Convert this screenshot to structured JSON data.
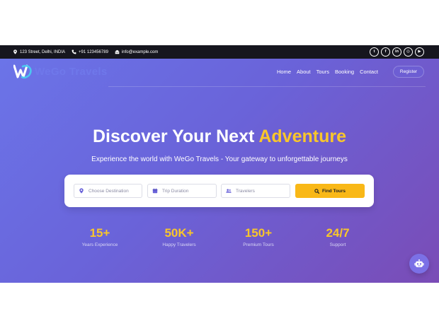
{
  "topbar": {
    "address": "123 Street, Delhi, INDIA",
    "phone": "+91 123456789",
    "email": "info@example.com",
    "social": [
      {
        "icon": "twitter-icon",
        "glyph": "t"
      },
      {
        "icon": "facebook-icon",
        "glyph": "f"
      },
      {
        "icon": "linkedin-icon",
        "glyph": "in"
      },
      {
        "icon": "instagram-icon",
        "glyph": "◎"
      },
      {
        "icon": "youtube-icon",
        "glyph": "▶"
      }
    ]
  },
  "brand": {
    "name": "WeGo Travels",
    "logo_text": "W"
  },
  "nav": {
    "items": [
      "Home",
      "About",
      "Tours",
      "Booking",
      "Contact"
    ],
    "register_label": "Register"
  },
  "hero": {
    "title_main": "Discover Your Next",
    "title_accent": "Adventure",
    "subtitle": "Experience the world with WeGo Travels - Your gateway to unforgettable journeys"
  },
  "search": {
    "destination_placeholder": "Choose Destination",
    "duration_placeholder": "Trip Duration",
    "travelers_placeholder": "Travelers",
    "button_label": "Find Tours"
  },
  "stats": [
    {
      "value": "15+",
      "label": "Years Experience"
    },
    {
      "value": "50K+",
      "label": "Happy Travelers"
    },
    {
      "value": "150+",
      "label": "Premium Tours"
    },
    {
      "value": "24/7",
      "label": "Support"
    }
  ],
  "colors": {
    "accent": "#f9c62b",
    "button": "#f9b817",
    "topbar": "#16161e",
    "hero_start": "#6b74e8",
    "hero_end": "#7a4cb6"
  }
}
